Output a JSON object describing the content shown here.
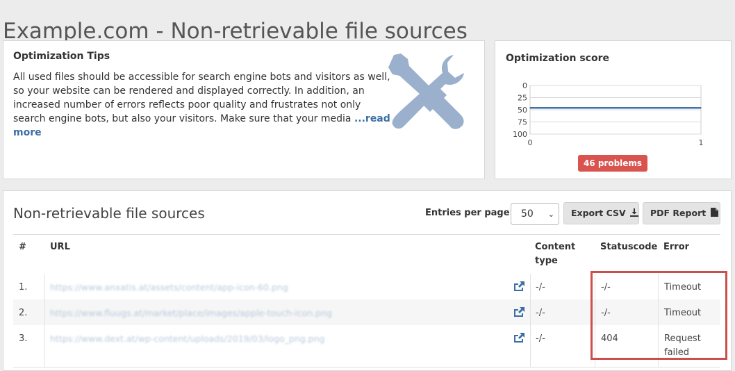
{
  "page": {
    "title": "Example.com - Non-retrievable file sources"
  },
  "tips": {
    "title": "Optimization Tips",
    "text": "All used files should be accessible for search engine bots and visitors as well, so your website can be rendered and displayed correctly. In addition, an increased number of errors reflects poor quality and frustrates not only search engine bots, but also your visitors. Make sure that your media",
    "read_more": "...read more",
    "icon": "tools-icon"
  },
  "score": {
    "title": "Optimization score",
    "problems_badge": "46 problems",
    "badge_color": "#d9534f"
  },
  "chart_data": {
    "type": "line",
    "x": [
      0,
      1
    ],
    "series": [
      {
        "values": [
          46,
          46
        ],
        "color": "#3f73a8"
      }
    ],
    "y_ticks": [
      "0",
      "25",
      "50",
      "75",
      "100"
    ],
    "x_ticks": [
      "0",
      "1"
    ],
    "ylim": [
      0,
      100
    ],
    "y_inverted": true,
    "xlim": [
      0,
      1
    ],
    "grid": true
  },
  "table": {
    "title": "Non-retrievable file sources",
    "entries_label": "Entries per page:",
    "entries_value": "50",
    "export_label": "Export CSV",
    "pdf_label": "PDF Report",
    "columns": {
      "num": "#",
      "url": "URL",
      "content_type": "Content type",
      "statuscode": "Statuscode",
      "error": "Error"
    },
    "rows": [
      {
        "num": "1.",
        "url": "https://www.anxatis.at/assets/content/app-icon-60.png",
        "content_type": "-/-",
        "statuscode": "-/-",
        "error": "Timeout"
      },
      {
        "num": "2.",
        "url": "https://www.fluugs.at/market/place/images/apple-touch-icon.png",
        "content_type": "-/-",
        "statuscode": "-/-",
        "error": "Timeout"
      },
      {
        "num": "3.",
        "url": "https://www.dext.at/wp-content/uploads/2019/03/logo_png.png",
        "content_type": "-/-",
        "statuscode": "404",
        "error": "Request failed"
      }
    ]
  }
}
